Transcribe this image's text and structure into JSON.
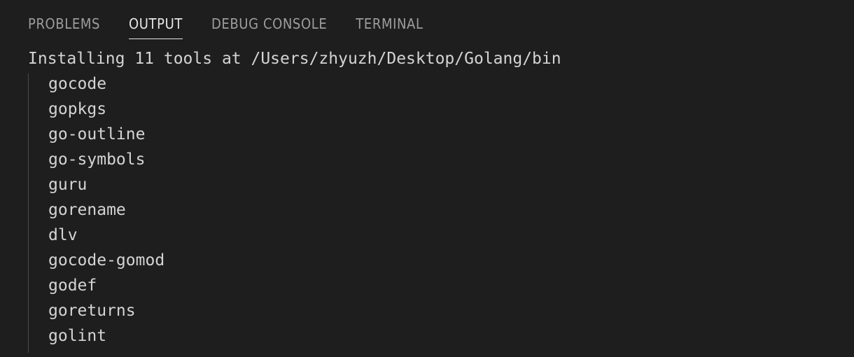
{
  "tabs": [
    {
      "label": "PROBLEMS",
      "active": false
    },
    {
      "label": "OUTPUT",
      "active": true
    },
    {
      "label": "DEBUG CONSOLE",
      "active": false
    },
    {
      "label": "TERMINAL",
      "active": false
    }
  ],
  "output": {
    "header": "Installing 11 tools at /Users/zhyuzh/Desktop/Golang/bin",
    "tools": [
      "gocode",
      "gopkgs",
      "go-outline",
      "go-symbols",
      "guru",
      "gorename",
      "dlv",
      "gocode-gomod",
      "godef",
      "goreturns",
      "golint"
    ]
  },
  "colors": {
    "background": "#1e1e1e",
    "text": "#d4d4d4",
    "tab_inactive": "#9d9d9d",
    "tab_active": "#e7e7e7",
    "guide_line": "#4a4a4a"
  }
}
